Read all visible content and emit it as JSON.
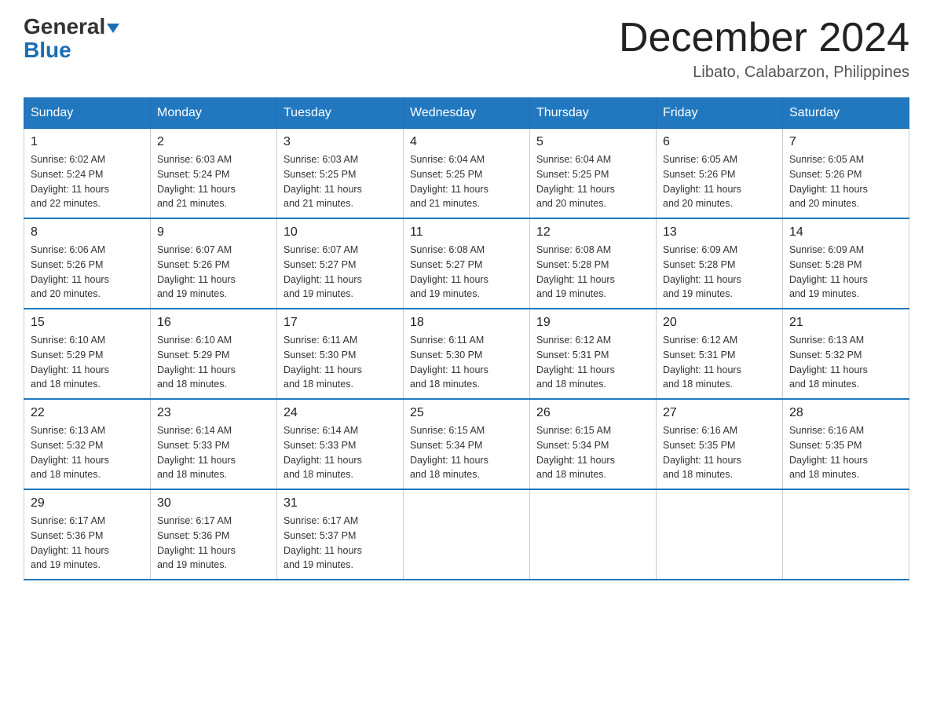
{
  "header": {
    "logo_general": "General",
    "logo_blue": "Blue",
    "month_title": "December 2024",
    "location": "Libato, Calabarzon, Philippines"
  },
  "days_of_week": [
    "Sunday",
    "Monday",
    "Tuesday",
    "Wednesday",
    "Thursday",
    "Friday",
    "Saturday"
  ],
  "weeks": [
    [
      {
        "day": "1",
        "sunrise": "6:02 AM",
        "sunset": "5:24 PM",
        "daylight": "11 hours and 22 minutes."
      },
      {
        "day": "2",
        "sunrise": "6:03 AM",
        "sunset": "5:24 PM",
        "daylight": "11 hours and 21 minutes."
      },
      {
        "day": "3",
        "sunrise": "6:03 AM",
        "sunset": "5:25 PM",
        "daylight": "11 hours and 21 minutes."
      },
      {
        "day": "4",
        "sunrise": "6:04 AM",
        "sunset": "5:25 PM",
        "daylight": "11 hours and 21 minutes."
      },
      {
        "day": "5",
        "sunrise": "6:04 AM",
        "sunset": "5:25 PM",
        "daylight": "11 hours and 20 minutes."
      },
      {
        "day": "6",
        "sunrise": "6:05 AM",
        "sunset": "5:26 PM",
        "daylight": "11 hours and 20 minutes."
      },
      {
        "day": "7",
        "sunrise": "6:05 AM",
        "sunset": "5:26 PM",
        "daylight": "11 hours and 20 minutes."
      }
    ],
    [
      {
        "day": "8",
        "sunrise": "6:06 AM",
        "sunset": "5:26 PM",
        "daylight": "11 hours and 20 minutes."
      },
      {
        "day": "9",
        "sunrise": "6:07 AM",
        "sunset": "5:26 PM",
        "daylight": "11 hours and 19 minutes."
      },
      {
        "day": "10",
        "sunrise": "6:07 AM",
        "sunset": "5:27 PM",
        "daylight": "11 hours and 19 minutes."
      },
      {
        "day": "11",
        "sunrise": "6:08 AM",
        "sunset": "5:27 PM",
        "daylight": "11 hours and 19 minutes."
      },
      {
        "day": "12",
        "sunrise": "6:08 AM",
        "sunset": "5:28 PM",
        "daylight": "11 hours and 19 minutes."
      },
      {
        "day": "13",
        "sunrise": "6:09 AM",
        "sunset": "5:28 PM",
        "daylight": "11 hours and 19 minutes."
      },
      {
        "day": "14",
        "sunrise": "6:09 AM",
        "sunset": "5:28 PM",
        "daylight": "11 hours and 19 minutes."
      }
    ],
    [
      {
        "day": "15",
        "sunrise": "6:10 AM",
        "sunset": "5:29 PM",
        "daylight": "11 hours and 18 minutes."
      },
      {
        "day": "16",
        "sunrise": "6:10 AM",
        "sunset": "5:29 PM",
        "daylight": "11 hours and 18 minutes."
      },
      {
        "day": "17",
        "sunrise": "6:11 AM",
        "sunset": "5:30 PM",
        "daylight": "11 hours and 18 minutes."
      },
      {
        "day": "18",
        "sunrise": "6:11 AM",
        "sunset": "5:30 PM",
        "daylight": "11 hours and 18 minutes."
      },
      {
        "day": "19",
        "sunrise": "6:12 AM",
        "sunset": "5:31 PM",
        "daylight": "11 hours and 18 minutes."
      },
      {
        "day": "20",
        "sunrise": "6:12 AM",
        "sunset": "5:31 PM",
        "daylight": "11 hours and 18 minutes."
      },
      {
        "day": "21",
        "sunrise": "6:13 AM",
        "sunset": "5:32 PM",
        "daylight": "11 hours and 18 minutes."
      }
    ],
    [
      {
        "day": "22",
        "sunrise": "6:13 AM",
        "sunset": "5:32 PM",
        "daylight": "11 hours and 18 minutes."
      },
      {
        "day": "23",
        "sunrise": "6:14 AM",
        "sunset": "5:33 PM",
        "daylight": "11 hours and 18 minutes."
      },
      {
        "day": "24",
        "sunrise": "6:14 AM",
        "sunset": "5:33 PM",
        "daylight": "11 hours and 18 minutes."
      },
      {
        "day": "25",
        "sunrise": "6:15 AM",
        "sunset": "5:34 PM",
        "daylight": "11 hours and 18 minutes."
      },
      {
        "day": "26",
        "sunrise": "6:15 AM",
        "sunset": "5:34 PM",
        "daylight": "11 hours and 18 minutes."
      },
      {
        "day": "27",
        "sunrise": "6:16 AM",
        "sunset": "5:35 PM",
        "daylight": "11 hours and 18 minutes."
      },
      {
        "day": "28",
        "sunrise": "6:16 AM",
        "sunset": "5:35 PM",
        "daylight": "11 hours and 18 minutes."
      }
    ],
    [
      {
        "day": "29",
        "sunrise": "6:17 AM",
        "sunset": "5:36 PM",
        "daylight": "11 hours and 19 minutes."
      },
      {
        "day": "30",
        "sunrise": "6:17 AM",
        "sunset": "5:36 PM",
        "daylight": "11 hours and 19 minutes."
      },
      {
        "day": "31",
        "sunrise": "6:17 AM",
        "sunset": "5:37 PM",
        "daylight": "11 hours and 19 minutes."
      },
      null,
      null,
      null,
      null
    ]
  ],
  "labels": {
    "sunrise": "Sunrise:",
    "sunset": "Sunset:",
    "daylight": "Daylight:"
  }
}
